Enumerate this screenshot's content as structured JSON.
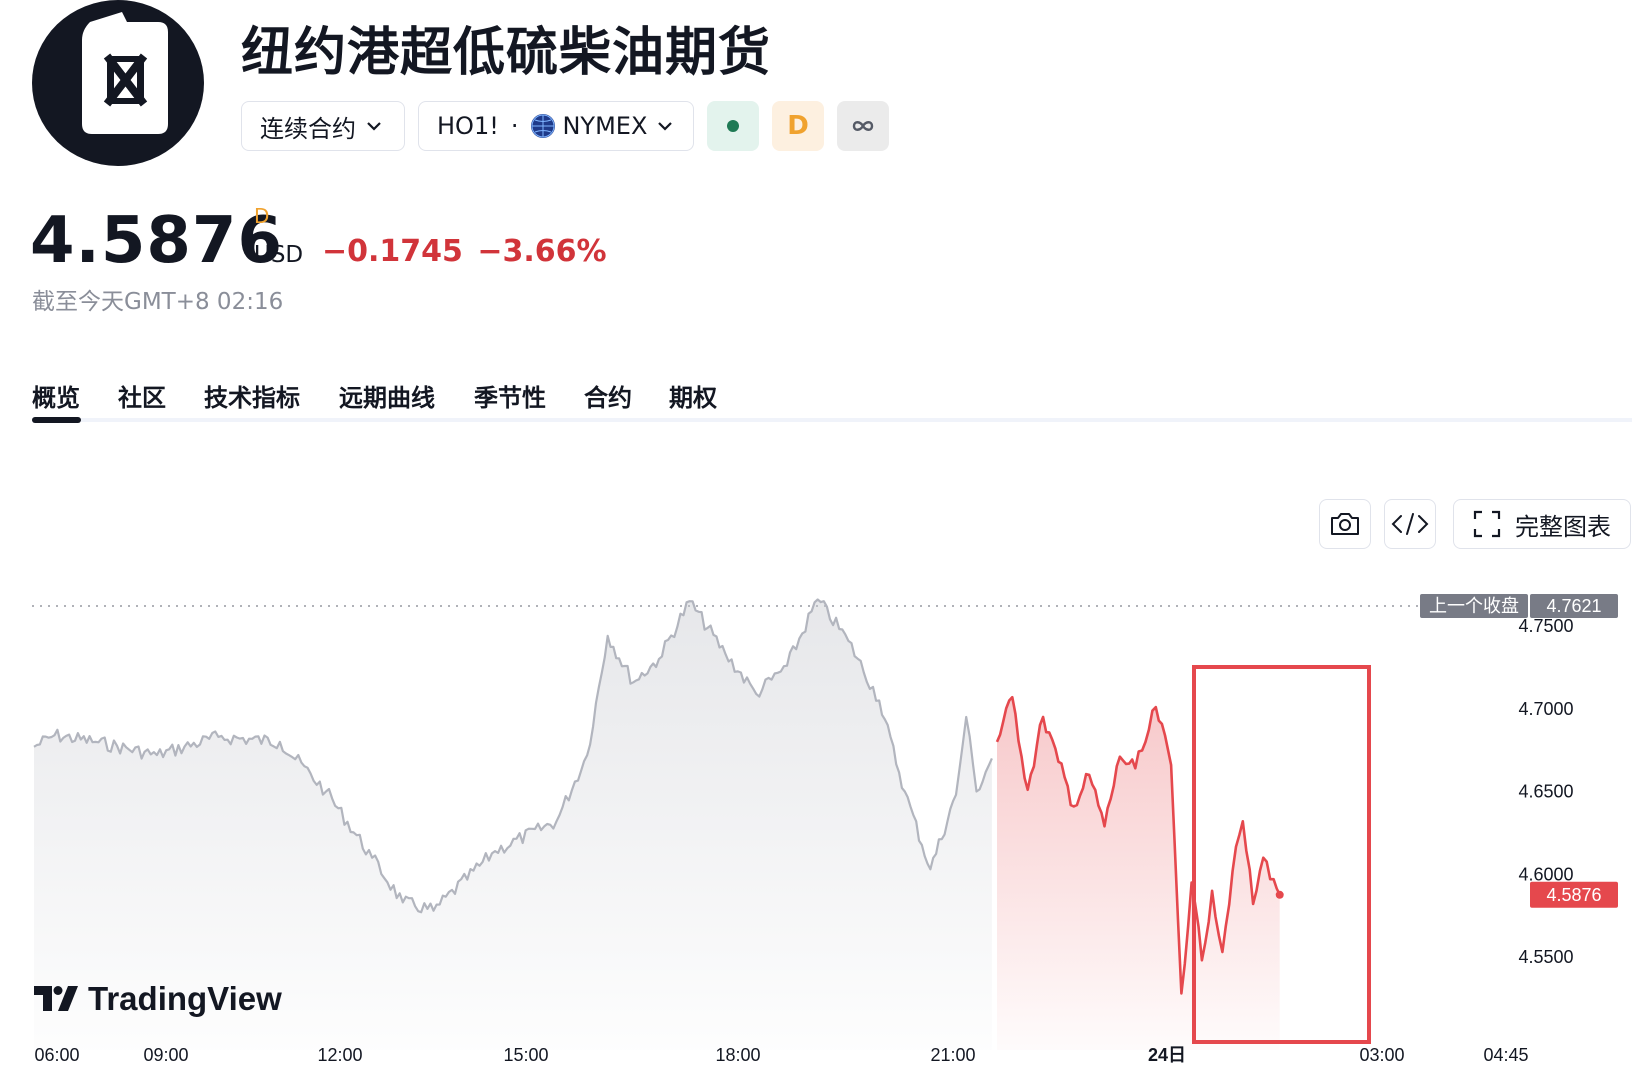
{
  "header": {
    "title": "纽约港超低硫柴油期货",
    "logo_icon": "fuel-can-icon",
    "contract_select": "连续合约",
    "symbol": "HO1!",
    "symbol_separator": "·",
    "exchange": "NYMEX",
    "badge_d": "D",
    "colors": {
      "market_open_dot": "#1f7a55",
      "badge_d": "#f0a22e",
      "infinity": "#555a66"
    }
  },
  "quote": {
    "price": "4.5876",
    "delay_flag": "D",
    "currency": "USD",
    "change": "−0.1745",
    "change_percent": "−3.66%",
    "as_of": "截至今天GMT+8 02:16",
    "change_color": "#d1343a"
  },
  "tabs": [
    {
      "label": "概览",
      "active": true
    },
    {
      "label": "社区"
    },
    {
      "label": "技术指标"
    },
    {
      "label": "远期曲线"
    },
    {
      "label": "季节性"
    },
    {
      "label": "合约"
    },
    {
      "label": "期权"
    }
  ],
  "toolbar": {
    "snapshot_icon": "camera-icon",
    "embed_icon": "code-icon",
    "fullscreen_icon": "expand-icon",
    "full_chart_label": "完整图表"
  },
  "chart_data": {
    "type": "area",
    "y_ticks": [
      "4.7500",
      "4.7000",
      "4.6500",
      "4.6000",
      "4.5500"
    ],
    "ylim": [
      4.52,
      4.772
    ],
    "x_ticks": [
      "06:00",
      "09:00",
      "12:00",
      "15:00",
      "18:00",
      "21:00",
      "24日",
      "03:00",
      "04:45"
    ],
    "previous_close": {
      "label": "上一个收盘",
      "value": 4.7621,
      "value_text": "4.7621"
    },
    "last_price": {
      "value": 4.5876,
      "value_text": "4.5876"
    },
    "watermark": "TradingView",
    "highlight_box_color": "#e5484d",
    "series": [
      {
        "session": "prior (gray)",
        "color": "#b2b5be",
        "x": [
          "06:00",
          "06:20",
          "07:00",
          "08:00",
          "09:00",
          "10:00",
          "10:45",
          "11:30",
          "12:00",
          "12:30",
          "13:30",
          "14:30",
          "15:00",
          "15:20",
          "15:45",
          "16:10",
          "16:40",
          "17:15",
          "17:45",
          "18:15",
          "18:45",
          "19:15",
          "19:45",
          "20:10",
          "20:35",
          "21:00",
          "21:10",
          "21:20",
          "21:35"
        ],
        "values": [
          4.677,
          4.684,
          4.68,
          4.672,
          4.683,
          4.68,
          4.65,
          4.61,
          4.583,
          4.578,
          4.614,
          4.632,
          4.672,
          4.744,
          4.716,
          4.73,
          4.765,
          4.733,
          4.709,
          4.726,
          4.766,
          4.741,
          4.705,
          4.65,
          4.603,
          4.648,
          4.695,
          4.65,
          4.67
        ]
      },
      {
        "session": "current (red)",
        "color": "#e5484d",
        "x": [
          "21:40",
          "21:55",
          "22:10",
          "22:25",
          "22:40",
          "22:55",
          "23:10",
          "23:25",
          "23:40",
          "23:55",
          "00:05",
          "00:15",
          "00:30",
          "00:40",
          "00:50",
          "01:00",
          "01:10",
          "01:20",
          "01:30",
          "01:40",
          "01:50",
          "02:00",
          "02:10",
          "02:16"
        ],
        "values": [
          4.68,
          4.707,
          4.651,
          4.695,
          4.668,
          4.641,
          4.66,
          4.629,
          4.671,
          4.664,
          4.68,
          4.701,
          4.666,
          4.528,
          4.595,
          4.548,
          4.59,
          4.553,
          4.602,
          4.632,
          4.582,
          4.61,
          4.597,
          4.5876
        ]
      }
    ]
  }
}
